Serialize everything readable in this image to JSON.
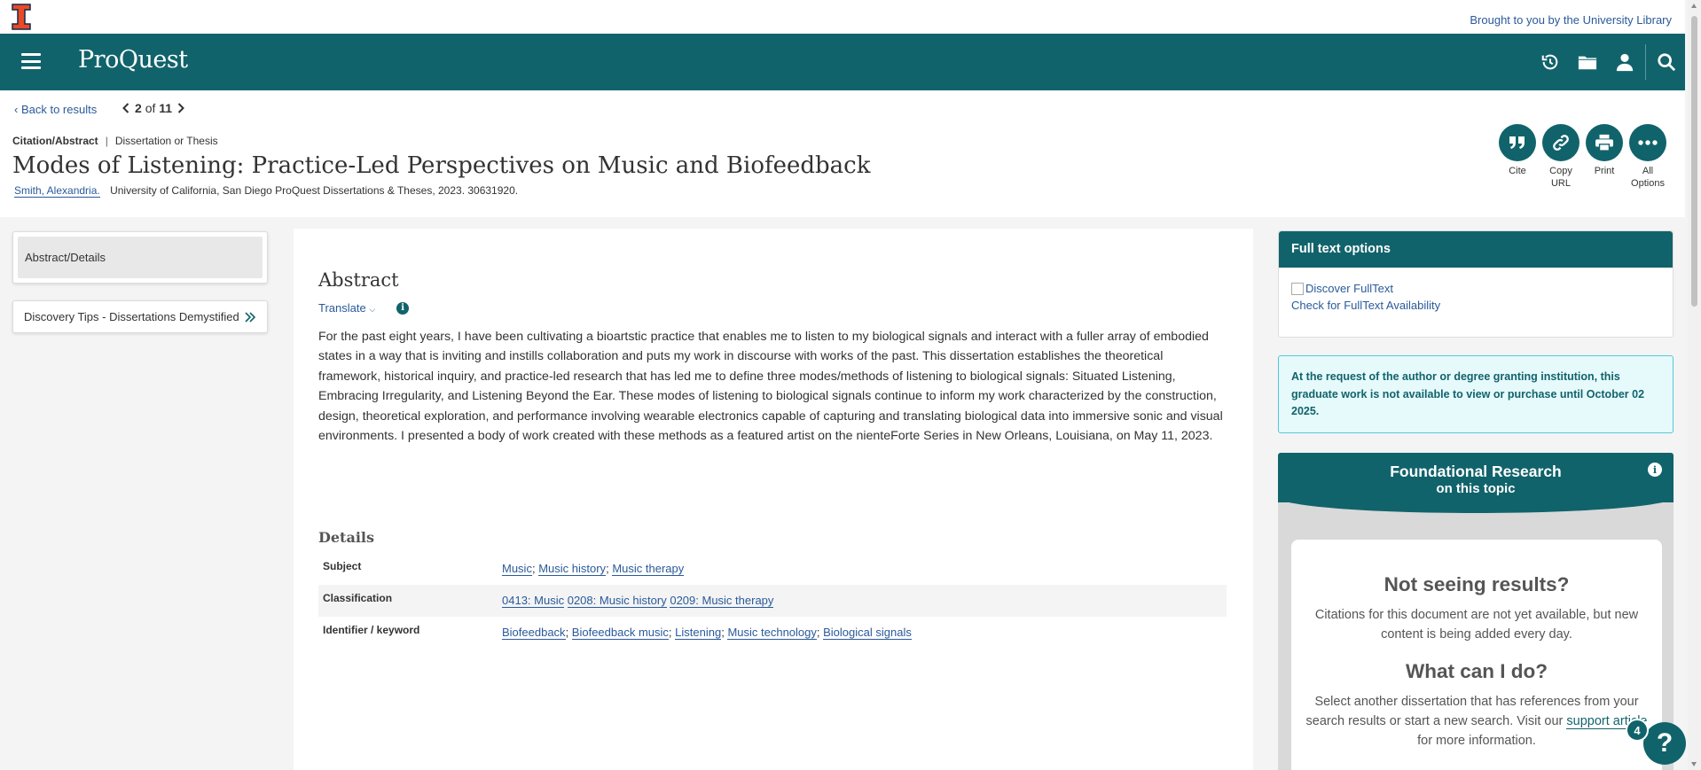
{
  "header": {
    "brought_by": "Brought to you by the University Library",
    "logo": "ProQuest",
    "icons": [
      "menu-icon",
      "history-icon",
      "folder-icon",
      "user-icon",
      "search-icon"
    ]
  },
  "nav": {
    "back_label": "Back to results",
    "pager_current": "2",
    "pager_of": "of",
    "pager_total": "11"
  },
  "document": {
    "crumb_type": "Citation/Abstract",
    "crumb_kind": "Dissertation or Thesis",
    "title": "Modes of Listening: Practice-Led Perspectives on Music and Biofeedback",
    "author": "Smith, Alexandria.",
    "source": "University of California, San Diego ProQuest Dissertations & Theses,  2023. 30631920."
  },
  "actions": [
    {
      "label": "Cite",
      "icon": "quote-icon"
    },
    {
      "label": "Copy URL",
      "icon": "link-icon"
    },
    {
      "label": "Print",
      "icon": "print-icon"
    },
    {
      "label": "All Options",
      "icon": "more-icon"
    }
  ],
  "sidebar": {
    "items": [
      {
        "label": "Abstract/Details"
      },
      {
        "label": "Discovery Tips - Dissertations Demystified"
      }
    ]
  },
  "abstract": {
    "heading": "Abstract",
    "translate_label": "Translate",
    "text": "For the past eight years, I have been cultivating a bioartstic practice that enables me to listen to my biological signals and interact with a fuller array of embodied states in a way that is inviting and instills collaboration and puts my work in discourse with works of the past. This dissertation establishes the theoretical framework, historical inquiry, and practice-led research that has led me to define three modes/methods of listening to biological signals: Situated Listening, Embracing Irregularity, and Listening Beyond the Ear. These modes of listening to biological signals continue to inform my work characterized by the construction, design, theoretical exploration, and performance involving wearable electronics capable of capturing and translating biological data into immersive sonic and visual environments. I presented a body of work created with these methods as a featured artist on the nienteForte Series in New Orleans, Louisiana, on May 11, 2023."
  },
  "details": {
    "heading": "Details",
    "subject_label": "Subject",
    "subjects": [
      "Music",
      "Music history",
      "Music therapy"
    ],
    "classification_label": "Classification",
    "classifications": [
      "0413: Music",
      "0208: Music history",
      "0209: Music therapy"
    ],
    "identifier_label": "Identifier / keyword",
    "keywords": [
      "Biofeedback",
      "Biofeedback music",
      "Listening",
      "Music technology",
      "Biological signals"
    ]
  },
  "fulltext": {
    "heading": "Full text options",
    "image_alt": "Discover FullText",
    "check_label": "Check for FullText Availability"
  },
  "notice": {
    "text": "At the request of the author or degree granting institution, this graduate work is not available to view or purchase until October 02 2025."
  },
  "foundational": {
    "title1": "Foundational Research",
    "title2": "on this topic",
    "no_results_heading": "Not seeing results?",
    "no_results_text": "Citations for this document are not yet available, but new content is being added every day.",
    "what_heading": "What can I do?",
    "what_text_before": "Select another dissertation that has references from your search results or start a new search. Visit our",
    "support_link": "support article",
    "what_text_after": "for more information."
  },
  "help": {
    "badge": "4",
    "label": "?"
  },
  "colors": {
    "brand": "#11636b",
    "link": "#2a5a9a",
    "notice_bg": "#e6fafc",
    "illinois_orange": "#e84a27"
  }
}
